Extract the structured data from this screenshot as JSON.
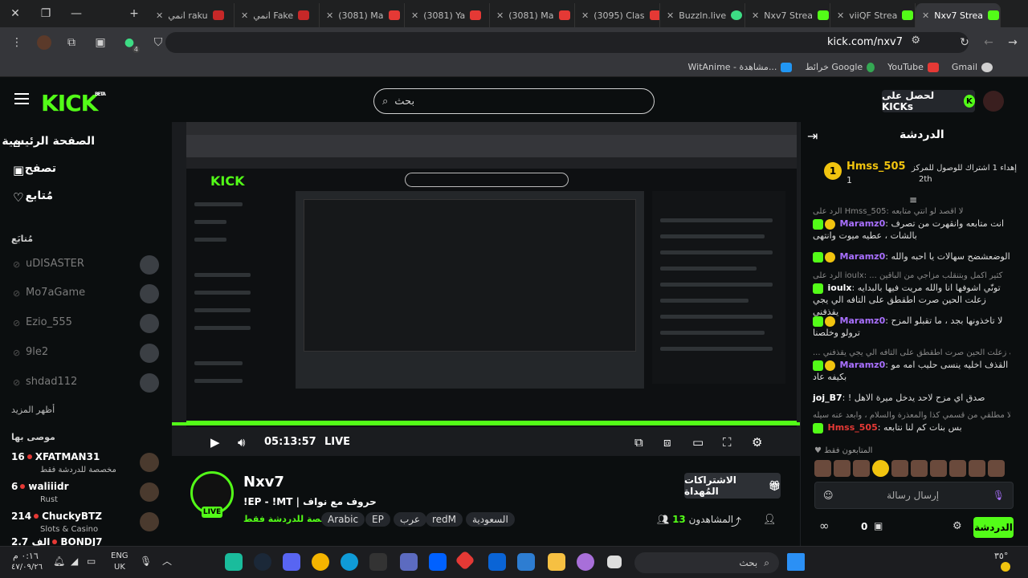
{
  "browser": {
    "tabs": [
      {
        "label": "انمي raku",
        "icon": "top-icon",
        "active": false
      },
      {
        "label": "انمي Fake",
        "icon": "top-icon",
        "active": false
      },
      {
        "label": "(3081) Ma",
        "icon": "youtube-icon",
        "active": false
      },
      {
        "label": "(3081) Ya",
        "icon": "youtube-icon",
        "active": false
      },
      {
        "label": "(3081) Ma",
        "icon": "youtube-icon",
        "active": false
      },
      {
        "label": "(3095) Clas",
        "icon": "youtube-icon",
        "active": false
      },
      {
        "label": "Buzzln.live",
        "icon": "buzz-icon",
        "active": false
      },
      {
        "label": "Nxv7 Strea",
        "icon": "kick-icon",
        "active": false
      },
      {
        "label": "viiQF Strea",
        "icon": "kick-icon",
        "active": false
      },
      {
        "label": "Nxv7 Strea",
        "icon": "kick-icon",
        "active": true
      }
    ],
    "url": "kick.com/nxv7",
    "extensions_badge": "4",
    "bookmarks": [
      {
        "label": "Gmail",
        "icon": "gmail-icon"
      },
      {
        "label": "YouTube",
        "icon": "youtube-icon"
      },
      {
        "label": "خرائط Google",
        "icon": "maps-icon"
      },
      {
        "label": "WitAnime - مشاهدة...",
        "icon": "witanime-icon"
      }
    ]
  },
  "header": {
    "logo": "KICK",
    "logo_sup": "BETA",
    "search_placeholder": "بحث",
    "get_kicks": "لحصل على KICKs"
  },
  "sidebar": {
    "nav": [
      {
        "label": "الصفحة الرئيسية",
        "icon": "home-icon"
      },
      {
        "label": "تصفح",
        "icon": "browse-icon"
      },
      {
        "label": "مُتابع",
        "icon": "heart-icon"
      }
    ],
    "following_title": "مُتابَع",
    "following": [
      "uDISASTER",
      "Mo7aGame",
      "Ezio_555",
      "9le2",
      "shdad112"
    ],
    "show_more": "أظهر المزيد",
    "recommended_title": "موصى بها",
    "recommended": [
      {
        "count": "16",
        "name": "XFATMAN31",
        "sub": "مخصصة للدردشة فقط"
      },
      {
        "count": "6",
        "name": "waliiidr",
        "sub": "Rust"
      },
      {
        "count": "214",
        "name": "ChuckyBTZ",
        "sub": "Slots & Casino"
      },
      {
        "count": "2.7 ألف",
        "name": "BONDJ7",
        "sub": ""
      }
    ]
  },
  "player": {
    "time": "05:13:57",
    "live": "LIVE",
    "progress": 1.0
  },
  "stream": {
    "channel": "Nxv7",
    "live_badge": "LIVE",
    "title": "!EP - !MT | حروف مع نواف",
    "category": "مخصصة للدردشة فقط",
    "tags": [
      "السعودية",
      "redM",
      "عرب",
      "EP",
      "Arabic"
    ],
    "sub_gift": "الاشتراكات المُهداة",
    "viewers_label": "المشاهدون",
    "viewers_count": "13"
  },
  "chat": {
    "title": "الدردشة",
    "pinned": {
      "text": "إهداء 1 اشتراك للوصول للمركز",
      "rank": "2th",
      "user": "Hmss_505",
      "amount": "1"
    },
    "messages": [
      {
        "reply": "الرد على Hmss_505: لا اقصد لو انتي متابعه",
        "user": "Maramz0",
        "color": "#a970ff",
        "text": "انت متابعه وانقهرت من تصرف بالشات ، عطيه ميوت وانتهى"
      },
      {
        "reply": "",
        "user": "Maramz0",
        "color": "#a970ff",
        "text": "الوضعشضح سهالات يا احبه والله"
      },
      {
        "reply": "الرد على ioulx: ... كثير اكمل وبتنقلب مزاجي من الباقين",
        "user": "ioulx",
        "color": "#ffffff",
        "text": "تونّي اشوفها انا والله مريت فيها بالبدايه زعلت الحين صرت اطقطق على التافه الي يجي يقذفني"
      },
      {
        "reply": "",
        "user": "Maramz0",
        "color": "#a970ff",
        "text": "لا تاخذونها بجد ، ما تقبلو المزح ترولو وخلصنا"
      },
      {
        "reply": "... فيها بالبدايه زعلت الحين صرت اطقطق على التافه الي يجي يقذفني",
        "user": "Maramz0",
        "color": "#a970ff",
        "text": "القذف اخليه ينسى حليب امه مو بكيفه عاد"
      },
      {
        "reply": "",
        "user": "joj_B7",
        "color": "#ffffff",
        "text": "! صدق اي مزح لاحد يدخل ميرة الاهل"
      },
      {
        "reply": "يشوف كلا مطلقي من قسمي كذا والمعذرة والسلام ، وابعد عنه سيله",
        "user": "Hmss_505",
        "color": "#e53935",
        "text": "بس بنات كم لنا نتابعه"
      }
    ],
    "followers_only": "المتابعون فقط",
    "input_placeholder": "إرسال رسالة",
    "send": "الدردشة",
    "kicks_count": "0"
  },
  "taskbar": {
    "search": "بحث",
    "lang": "ENG",
    "region": "UK",
    "time": "٠:١٦ م",
    "date": "٤٧/٠٩/٢٦",
    "temp": "٣٥°"
  }
}
